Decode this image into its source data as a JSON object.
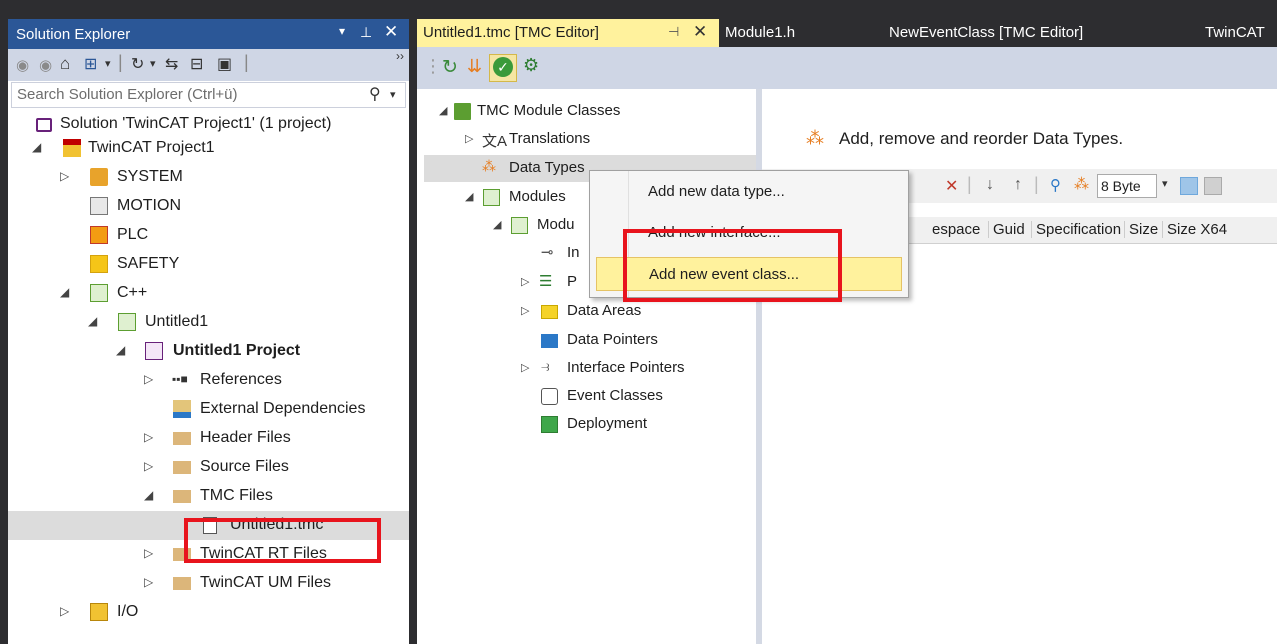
{
  "solution_explorer": {
    "title": "Solution Explorer",
    "title_icons": [
      "dropdown-arrow-icon",
      "pin-icon",
      "close-icon"
    ],
    "toolbar_icons": [
      "back-icon",
      "forward-icon",
      "home-icon",
      "switch-views-icon",
      "dropdown-icon",
      "pending-changes-icon",
      "dropdown-icon",
      "sync-icon",
      "collapse-all-icon",
      "properties-icon",
      "overflow-icon"
    ],
    "search_placeholder": "Search Solution Explorer (Ctrl+ü)",
    "tree": {
      "solution": "Solution 'TwinCAT Project1' (1 project)",
      "project": "TwinCAT Project1",
      "system": "SYSTEM",
      "motion": "MOTION",
      "plc": "PLC",
      "safety": "SAFETY",
      "cpp": "C++",
      "untitled1": "Untitled1",
      "untitled1_project": "Untitled1 Project",
      "references": "References",
      "external_dependencies": "External Dependencies",
      "header_files": "Header Files",
      "source_files": "Source Files",
      "tmc_files": "TMC Files",
      "untitled1_tmc": "Untitled1.tmc",
      "twincat_rt_files": "TwinCAT RT Files",
      "twincat_um_files": "TwinCAT UM Files",
      "io": "I/O"
    }
  },
  "editor": {
    "tabs": [
      {
        "label": "Untitled1.tmc [TMC Editor]",
        "active": true
      },
      {
        "label": "Module1.h",
        "active": false
      },
      {
        "label": "NewEventClass [TMC Editor]",
        "active": false
      },
      {
        "label": "TwinCAT",
        "active": false
      }
    ],
    "toolbar_icons": [
      "refresh-icon",
      "update-icon",
      "check-icon",
      "settings-icon"
    ],
    "tree": {
      "root": "TMC Module Classes",
      "translations": "Translations",
      "data_types": "Data Types",
      "modules": "Modules",
      "module_truncated": "Modu",
      "child_i": "In",
      "child_p": "P",
      "data_areas": "Data Areas",
      "data_pointers": "Data Pointers",
      "interface_pointers": "Interface Pointers",
      "event_classes": "Event Classes",
      "deployment": "Deployment"
    },
    "header_text": "Add, remove and reorder Data Types.",
    "size_select": "8 Byte",
    "columns": [
      "espace",
      "Guid",
      "Specification",
      "Size",
      "Size X64"
    ]
  },
  "context_menu": {
    "items": [
      "Add new data type...",
      "Add new interface...",
      "Add new event class..."
    ],
    "highlighted_index": 2
  },
  "colors": {
    "vs_blue": "#2b5797",
    "dark_chrome": "#2d2d30",
    "active_tab": "#fff29d",
    "toolbar": "#cfd6e5",
    "selection": "#cce8ff",
    "selected_gray": "#dcdcdc",
    "highlight_red": "#e8141d"
  }
}
